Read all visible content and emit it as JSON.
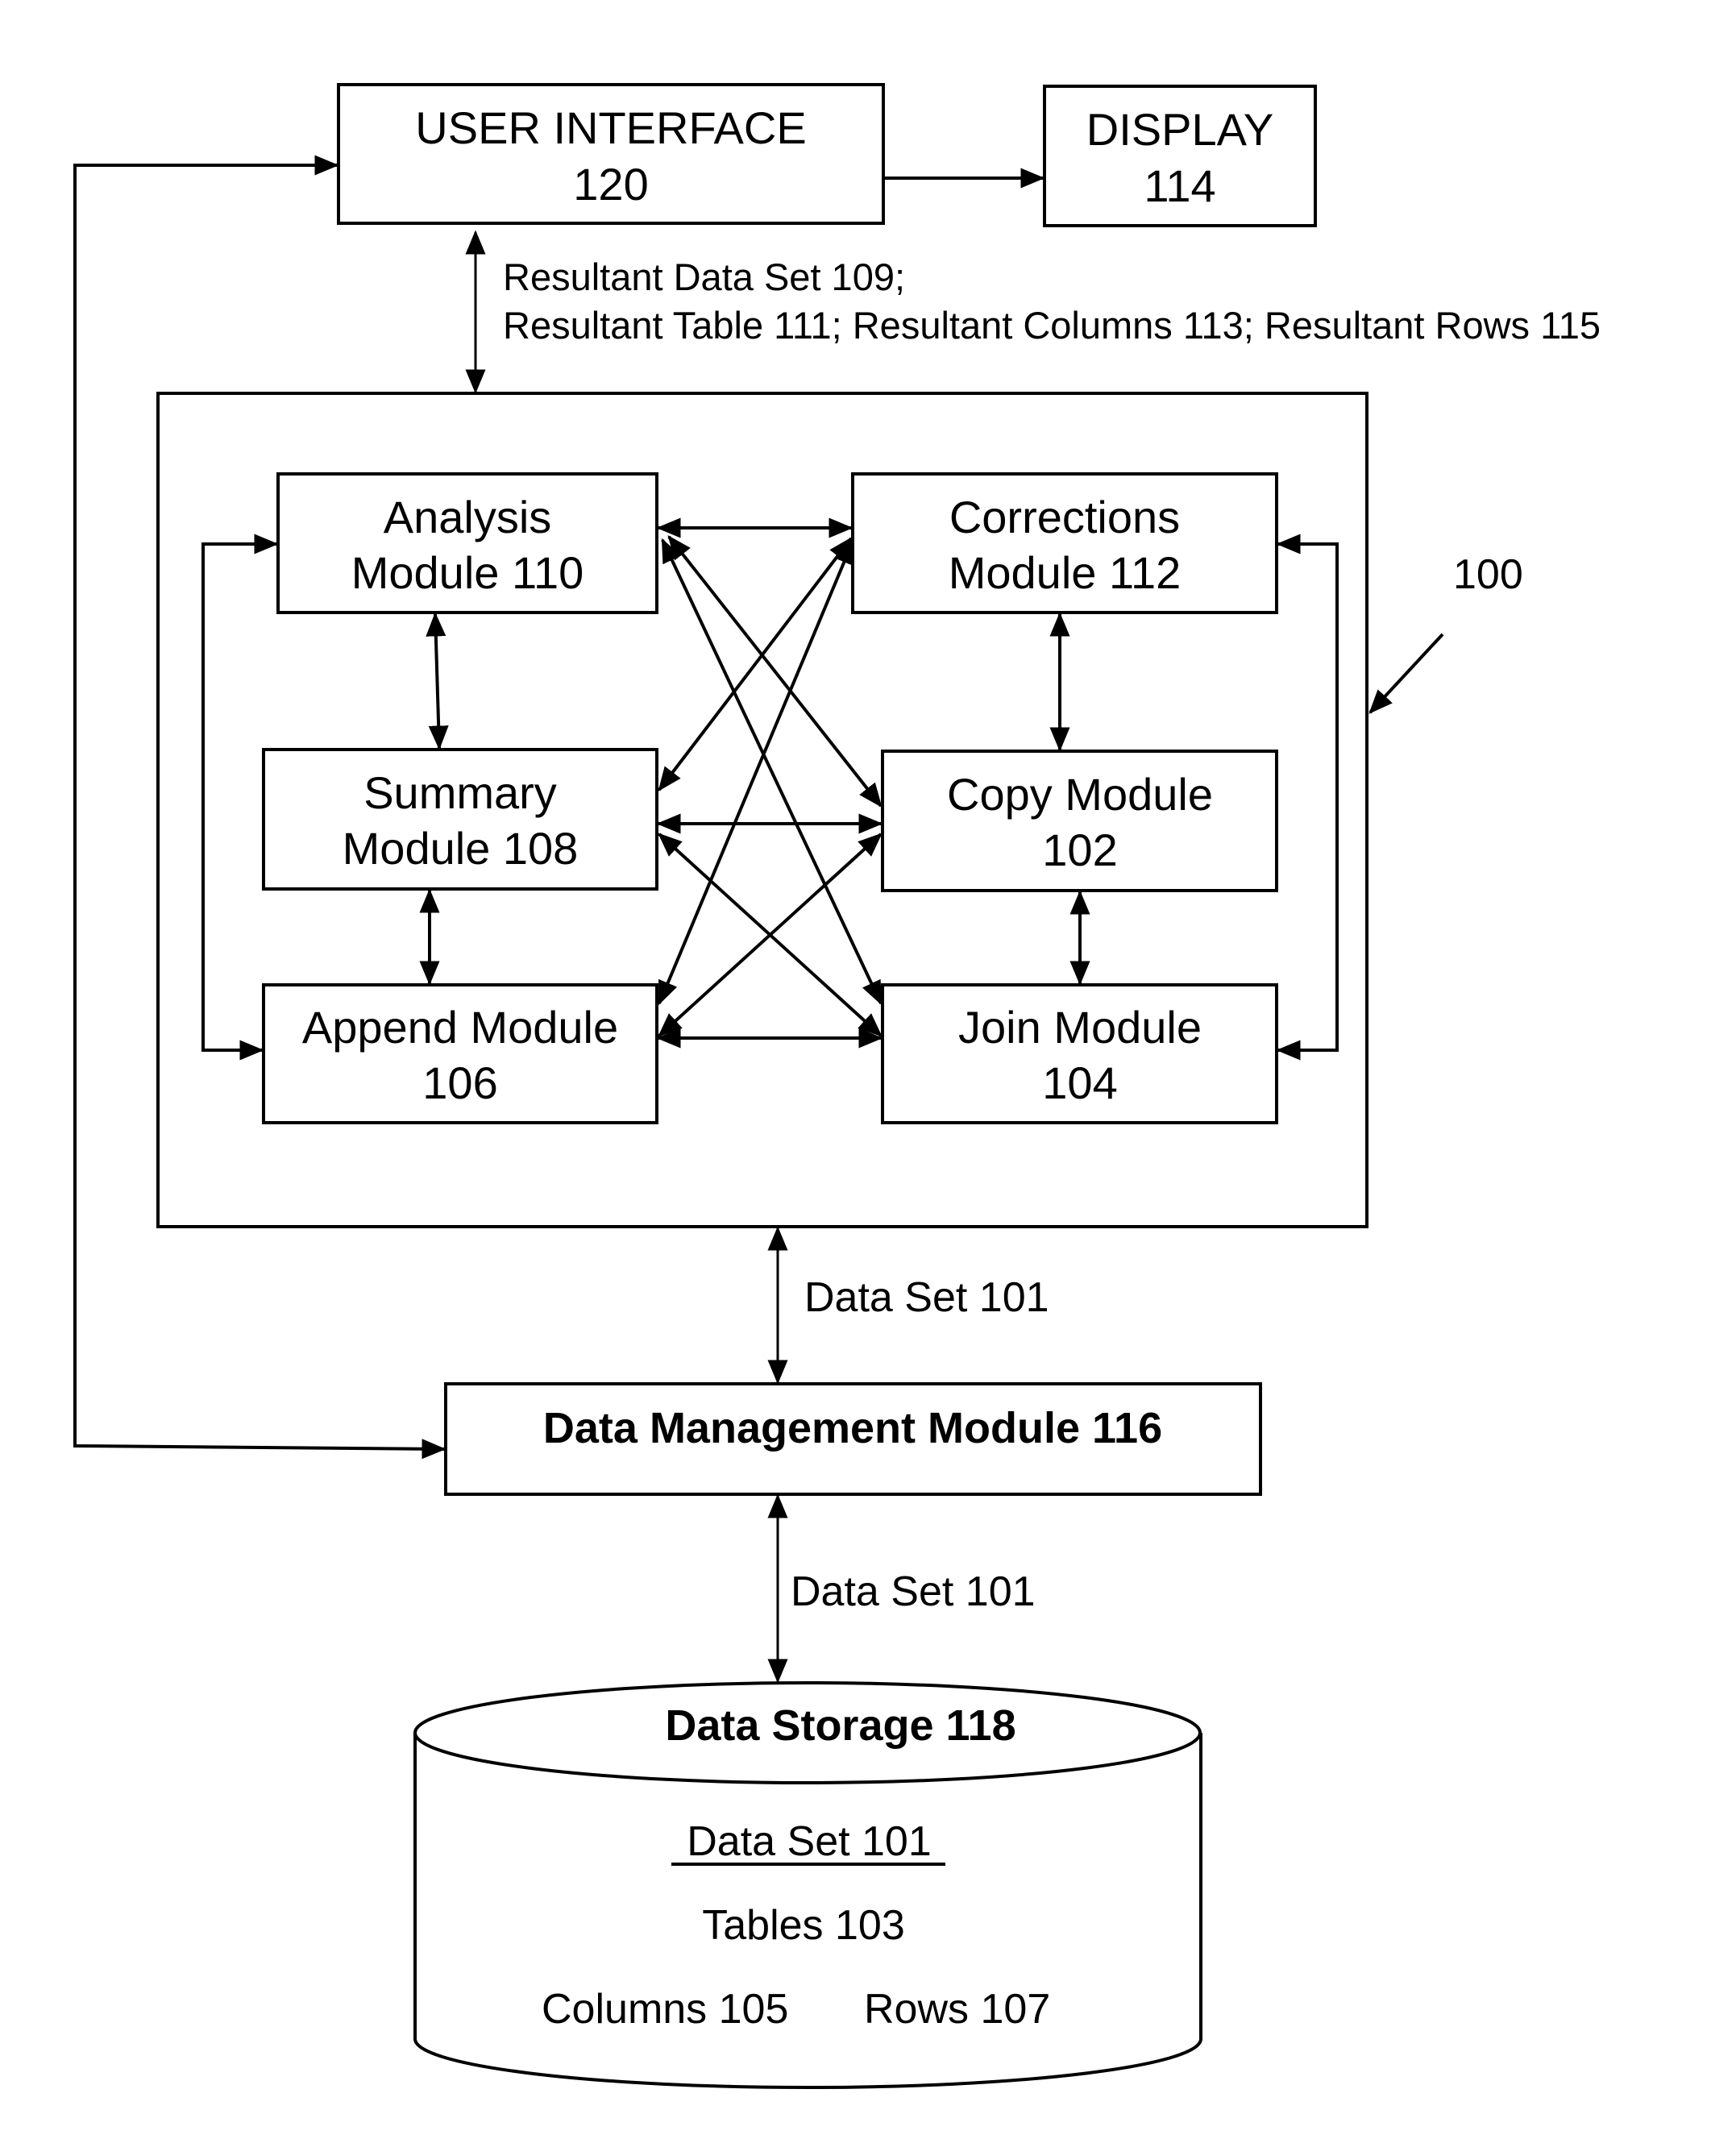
{
  "top": {
    "user_interface": {
      "line1": "USER INTERFACE",
      "line2": "120"
    },
    "display": {
      "line1": "DISPLAY",
      "line2": "114"
    },
    "resultant_label": {
      "line1": "Resultant Data Set 109;",
      "line2": "Resultant Table 111; Resultant Columns 113; Resultant Rows 115"
    }
  },
  "system": {
    "reference": "100",
    "modules": [
      {
        "id": "analysis",
        "line1": "Analysis",
        "line2": "Module 110"
      },
      {
        "id": "corrections",
        "line1": "Corrections",
        "line2": "Module 112"
      },
      {
        "id": "summary",
        "line1": "Summary",
        "line2": "Module 108"
      },
      {
        "id": "copy",
        "line1": "Copy Module",
        "line2": "102"
      },
      {
        "id": "append",
        "line1": "Append Module",
        "line2": "106"
      },
      {
        "id": "join",
        "line1": "Join Module",
        "line2": "104"
      }
    ],
    "connections": [
      [
        "analysis",
        "corrections"
      ],
      [
        "analysis",
        "summary"
      ],
      [
        "analysis",
        "copy"
      ],
      [
        "analysis",
        "join"
      ],
      [
        "corrections",
        "copy"
      ],
      [
        "corrections",
        "summary"
      ],
      [
        "corrections",
        "append"
      ],
      [
        "summary",
        "copy"
      ],
      [
        "summary",
        "append"
      ],
      [
        "summary",
        "join"
      ],
      [
        "copy",
        "join"
      ],
      [
        "copy",
        "append"
      ],
      [
        "append",
        "join"
      ],
      [
        "analysis",
        "append"
      ],
      [
        "corrections",
        "join"
      ]
    ]
  },
  "data_flow": {
    "upper_label": "Data Set 101",
    "data_management": "Data Management Module 116",
    "lower_label": "Data Set 101"
  },
  "storage": {
    "title": "Data Storage 118",
    "data_set": "Data Set 101",
    "tables": "Tables 103",
    "columns": "Columns 105",
    "rows": "Rows 107"
  },
  "colors": {
    "stroke": "#000000",
    "background": "#ffffff"
  }
}
